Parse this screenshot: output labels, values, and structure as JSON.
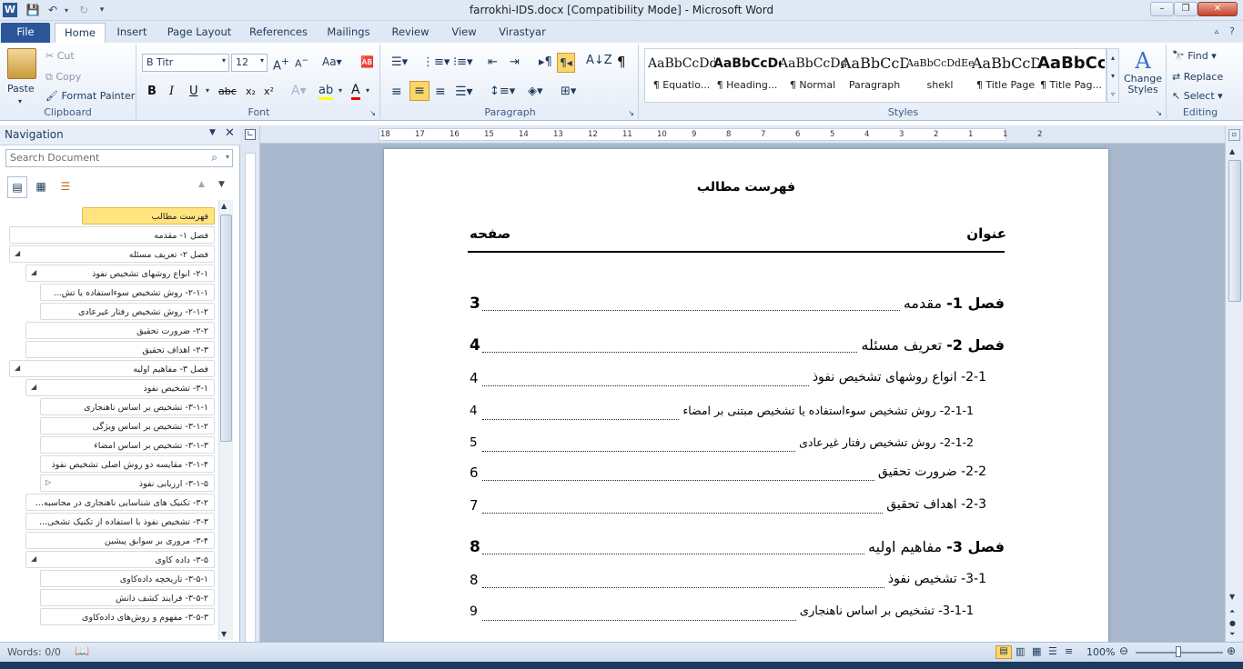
{
  "window": {
    "title": "farrokhi-IDS.docx [Compatibility Mode]  -  Microsoft Word",
    "app_icon": "W"
  },
  "tabs": [
    "File",
    "Home",
    "Insert",
    "Page Layout",
    "References",
    "Mailings",
    "Review",
    "View",
    "Virastyar"
  ],
  "clipboard": {
    "paste": "Paste",
    "cut": "Cut",
    "copy": "Copy",
    "format_painter": "Format Painter",
    "label": "Clipboard"
  },
  "font": {
    "name": "B Titr",
    "size": "12",
    "label": "Font",
    "bold": "B",
    "italic": "I",
    "underline": "U",
    "strike": "abc",
    "sub": "x₂",
    "sup": "x²"
  },
  "paragraph": {
    "label": "Paragraph"
  },
  "styles": {
    "label": "Styles",
    "items": [
      {
        "preview": "AaBbCcDdEe",
        "name": "¶ Equatio..."
      },
      {
        "preview": "AaBbCcDdEe",
        "name": "¶ Heading..."
      },
      {
        "preview": "AaBbCcDdEe",
        "name": "¶ Normal"
      },
      {
        "preview": "AaBbCcDdEe",
        "name": "Paragraph"
      },
      {
        "preview": "AaBbCcDdEe",
        "name": "shekl"
      },
      {
        "preview": "AaBbCcDdEe",
        "name": "¶ Title Page"
      },
      {
        "preview": "AaBbCcDdEe",
        "name": "¶ Title Pag..."
      }
    ],
    "change_styles": "Change Styles"
  },
  "editing": {
    "find": "Find",
    "replace": "Replace",
    "select": "Select",
    "label": "Editing"
  },
  "navigation": {
    "title": "Navigation",
    "search_placeholder": "Search Document",
    "items": [
      {
        "text": "فهرست مطالب",
        "level": 0,
        "selected": true,
        "expander": ""
      },
      {
        "text": "فصل ۱- مقدمه",
        "level": 0,
        "selected": false,
        "expander": ""
      },
      {
        "text": "فصل ۲- تعریف مسئله",
        "level": 0,
        "selected": false,
        "expander": "◢"
      },
      {
        "text": "۲-۱- انواع روشهای تشخیص نفوذ",
        "level": 1,
        "selected": false,
        "expander": "◢"
      },
      {
        "text": "۲-۱-۱- روش تشخیص سوءاستفاده یا تش...",
        "level": 2,
        "selected": false,
        "expander": ""
      },
      {
        "text": "۲-۱-۲- روش تشخیص رفتار غیرعادی",
        "level": 2,
        "selected": false,
        "expander": ""
      },
      {
        "text": "۲-۲- ضرورت تحقیق",
        "level": 1,
        "selected": false,
        "expander": ""
      },
      {
        "text": "۲-۳- اهداف تحقیق",
        "level": 1,
        "selected": false,
        "expander": ""
      },
      {
        "text": "فصل ۳- مفاهیم اولیه",
        "level": 0,
        "selected": false,
        "expander": "◢"
      },
      {
        "text": "۳-۱- تشخیص نفوذ",
        "level": 1,
        "selected": false,
        "expander": "◢"
      },
      {
        "text": "۳-۱-۱- تشخیص بر اساس ناهنجاری",
        "level": 2,
        "selected": false,
        "expander": ""
      },
      {
        "text": "۳-۱-۲- تشخیص بر اساس ویژگی",
        "level": 2,
        "selected": false,
        "expander": ""
      },
      {
        "text": "۳-۱-۳- تشخیص بر اساس امضاء",
        "level": 2,
        "selected": false,
        "expander": ""
      },
      {
        "text": "۳-۱-۴- مقایسه دو روش اصلی تشخیص نفوذ",
        "level": 2,
        "selected": false,
        "expander": ""
      },
      {
        "text": "۳-۱-۵- ارزیابی نفوذ",
        "level": 2,
        "selected": false,
        "expander": "▷"
      },
      {
        "text": "۳-۲- تکنیک های شناسایی ناهنجاری در محاسبه...",
        "level": 1,
        "selected": false,
        "expander": ""
      },
      {
        "text": "۳-۳- تشخیص نفوذ با استفاده از تکنیک تشخی...",
        "level": 1,
        "selected": false,
        "expander": ""
      },
      {
        "text": "۳-۴- مروری بر سوابق پیشین",
        "level": 1,
        "selected": false,
        "expander": ""
      },
      {
        "text": "۳-۵- داده کاوی",
        "level": 1,
        "selected": false,
        "expander": "◢"
      },
      {
        "text": "۳-۵-۱- تاریخچه داده‌کاوی",
        "level": 2,
        "selected": false,
        "expander": ""
      },
      {
        "text": "۳-۵-۲- فرایند کشف دانش",
        "level": 2,
        "selected": false,
        "expander": ""
      },
      {
        "text": "۳-۵-۳- مفهوم و روش‌های داده‌کاوی",
        "level": 2,
        "selected": false,
        "expander": ""
      }
    ]
  },
  "ruler": {
    "ticks": [
      "18",
      "17",
      "16",
      "15",
      "14",
      "13",
      "12",
      "11",
      "10",
      "9",
      "8",
      "7",
      "6",
      "5",
      "4",
      "3",
      "2",
      "1",
      "1",
      "2"
    ]
  },
  "document": {
    "heading": "فهرست مطالب",
    "col_title": "عنوان",
    "col_page": "صفحه",
    "toc": [
      {
        "num": "فصل 1-",
        "title": "مقدمه",
        "page": "3",
        "level": 0
      },
      {
        "num": "فصل 2-",
        "title": "تعریف مسئله",
        "page": "4",
        "level": 0
      },
      {
        "num": "2-1-",
        "title": "انواع روشهای تشخیص نفوذ",
        "page": "4",
        "level": 1
      },
      {
        "num": "2-1-1-",
        "title": "روش تشخیص سوءاستفاده یا تشخیص مبتنی بر امضاء",
        "page": "4",
        "level": 2
      },
      {
        "num": "2-1-2-",
        "title": "روش تشخیص رفتار غیرعادی",
        "page": "5",
        "level": 2
      },
      {
        "num": "2-2-",
        "title": "ضرورت تحقیق",
        "page": "6",
        "level": 1
      },
      {
        "num": "2-3-",
        "title": "اهداف تحقیق",
        "page": "7",
        "level": 1
      },
      {
        "num": "فصل 3-",
        "title": "مفاهیم اولیه",
        "page": "8",
        "level": 0
      },
      {
        "num": "3-1-",
        "title": "تشخیص نفوذ",
        "page": "8",
        "level": 1
      },
      {
        "num": "3-1-1-",
        "title": "تشخیص بر اساس ناهنجاری",
        "page": "9",
        "level": 2
      }
    ]
  },
  "status": {
    "words": "Words: 0/0",
    "zoom": "100%"
  }
}
